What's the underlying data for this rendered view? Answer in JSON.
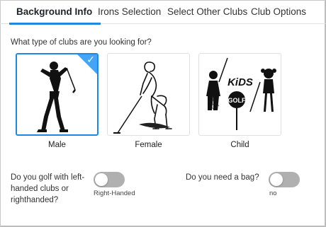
{
  "tabs": [
    {
      "label": "Background Info",
      "active": true
    },
    {
      "label": "Irons Selection",
      "active": false
    },
    {
      "label": "Select Other Clubs",
      "active": false
    },
    {
      "label": "Club Options",
      "active": false
    }
  ],
  "accent_color": "#1e88e5",
  "club_question": "What type of clubs are you looking for?",
  "options": [
    {
      "label": "Male",
      "selected": true
    },
    {
      "label": "Female",
      "selected": false
    },
    {
      "label": "Child",
      "selected": false,
      "logo_lines": [
        "KiDS",
        "GOLF"
      ]
    }
  ],
  "hand_question": "Do you golf with left-handed clubs or righthanded?",
  "hand_toggle": {
    "caption": "Right-Handed",
    "on": false
  },
  "bag_question": "Do you need a bag?",
  "bag_toggle": {
    "caption": "no",
    "on": false
  },
  "icons": {
    "check": "checkmark-icon"
  }
}
